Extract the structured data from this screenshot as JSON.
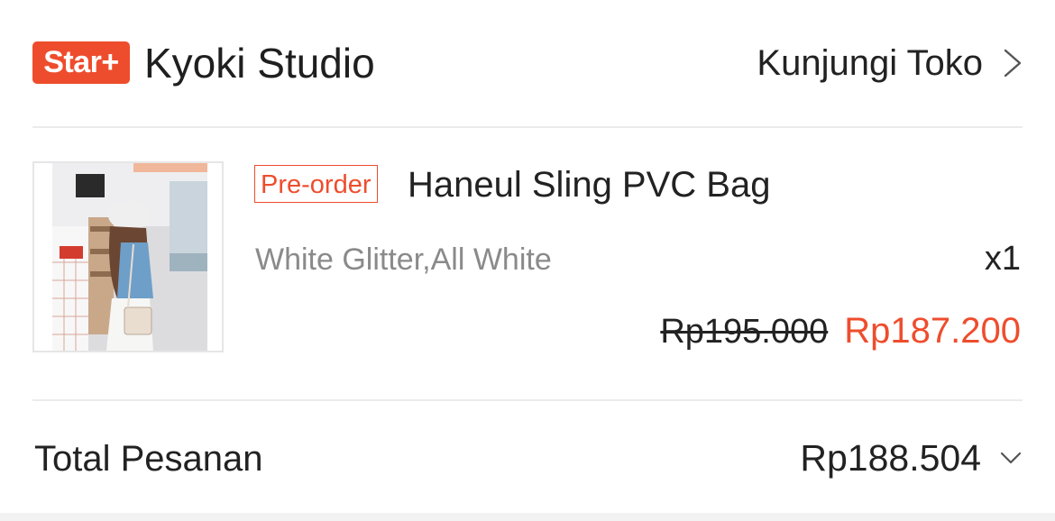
{
  "shop": {
    "badge": "Star+",
    "name": "Kyoki Studio",
    "visit_label": "Kunjungi Toko",
    "visit_icon": "chevron-right-icon"
  },
  "product": {
    "tag": "Pre-order",
    "name": "Haneul Sling PVC Bag",
    "variation": "White Glitter,All White",
    "quantity": "x1",
    "price_original": "Rp195.000",
    "price_discount": "Rp187.200",
    "image_alt": "product photo"
  },
  "order": {
    "total_label": "Total Pesanan",
    "total_value": "Rp188.504",
    "expand_icon": "chevron-down-icon"
  },
  "colors": {
    "accent": "#ee4d2d",
    "text": "#222222",
    "muted": "#8a8a8a",
    "divider": "#ebebeb"
  }
}
